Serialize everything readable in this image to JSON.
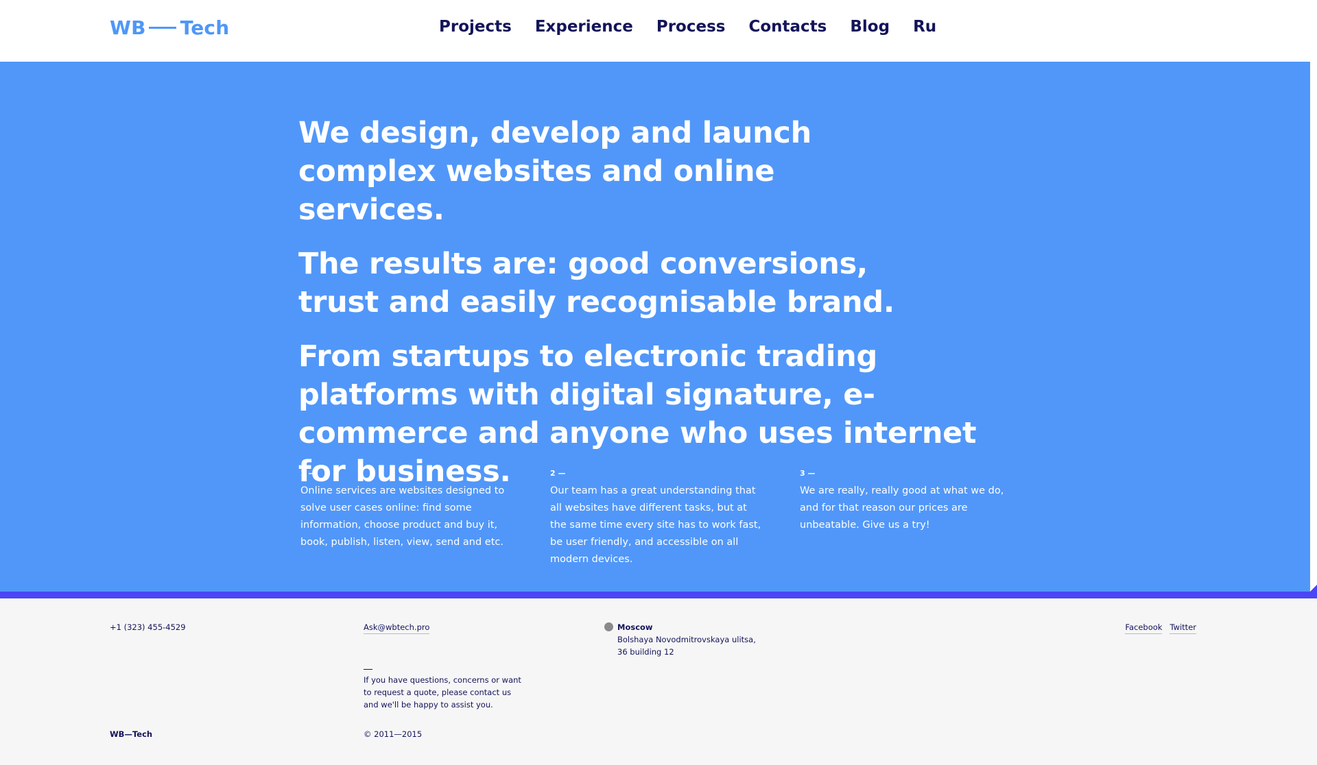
{
  "header": {
    "logo_left": "WB",
    "logo_right": "Tech",
    "nav": [
      "Projects",
      "Experience",
      "Process",
      "Contacts",
      "Blog",
      "Ru"
    ]
  },
  "hero": {
    "paragraphs": [
      "We design, develop and launch complex websites and online services.",
      "The results are: good conversions, trust and easily recognisable brand.",
      "From startups to electronic trading platforms with digital signature, e-commerce and anyone who uses internet for business."
    ],
    "features": [
      {
        "num": "1 —",
        "text": "Online services are websites designed to solve user cases online: find some information, choose product and buy it, book, publish, listen, view, send and etc."
      },
      {
        "num": "2 —",
        "text": "Our team has a great understanding that all websites have different tasks, but at the same time every site has to work fast, be user friendly, and accessible on all modern devices."
      },
      {
        "num": "3 —",
        "text": "We are really, really good at what we do, and for that reason our prices are unbeatable. Give us a try!"
      }
    ]
  },
  "footer": {
    "phone": "+1 (323) 455-4529",
    "email": "Ask@wbtech.pro",
    "note": "If you have questions, concerns or want to request a quote, please contact us and we'll be happy to assist you.",
    "city": "Moscow",
    "address": "Bolshaya Novodmitrovskaya ulitsa, 36 building 12",
    "social": [
      "Facebook",
      "Twitter"
    ],
    "brand": "WB—Tech",
    "copyright": "© 2011—2015"
  },
  "colors": {
    "accent": "#5197f9",
    "logo": "#4f97f8",
    "bar": "#4a46f5",
    "text_dark": "#14145a",
    "footer_bg": "#f6f6f6"
  }
}
